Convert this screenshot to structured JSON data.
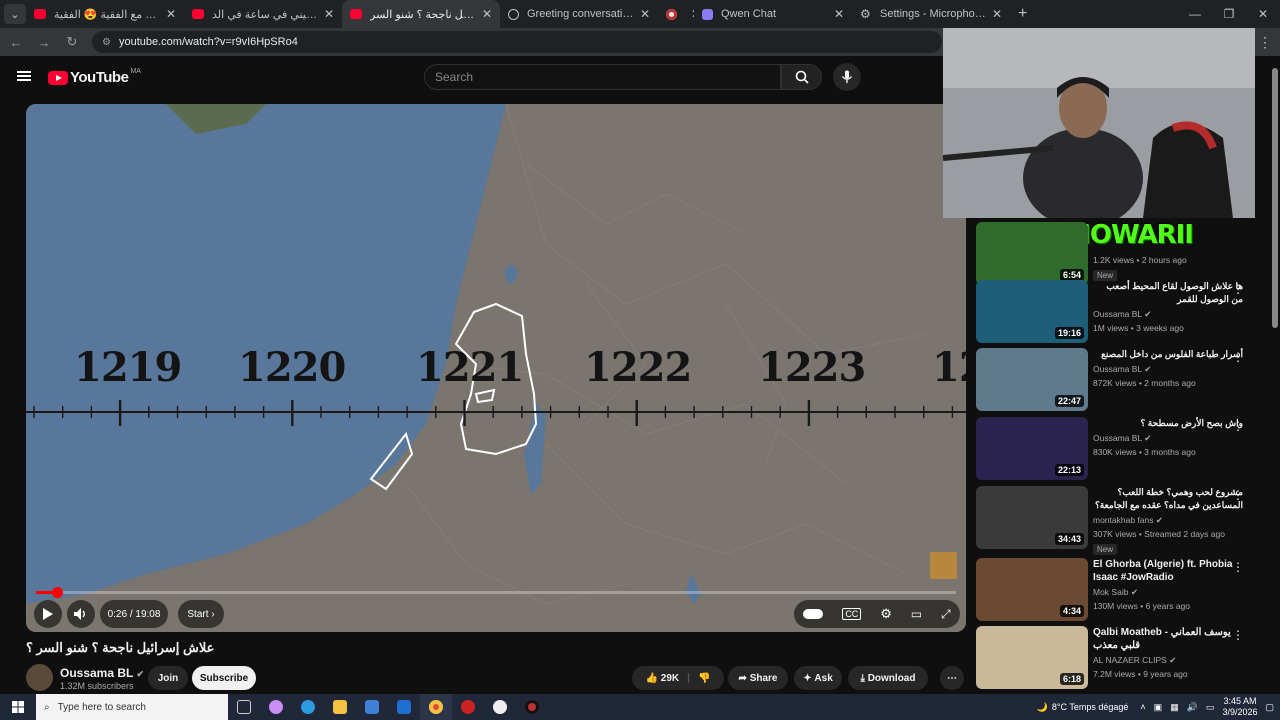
{
  "browser": {
    "tabs": [
      {
        "title": "برنامج الزواج مع الفقية 😍 الفقية",
        "icon": "youtube-icon"
      },
      {
        "title": "الحسين الدجيني في ساعة في الد...",
        "icon": "youtube-icon"
      },
      {
        "title": "علاش إسرائيل ناجحة ؟ شنو السر",
        "icon": "youtube-icon",
        "active": true
      },
      {
        "title": "Greeting conversation",
        "icon": "globe-icon"
      },
      {
        "title": "",
        "icon": "record-icon"
      },
      {
        "title": "Qwen Chat",
        "icon": "qwen-icon"
      },
      {
        "title": "Settings - Microphone",
        "icon": "gear-icon"
      }
    ],
    "url": "youtube.com/watch?v=r9vI6HpSRo4"
  },
  "youtube": {
    "logo": "YouTube",
    "country_code": "MA",
    "search_placeholder": "Search"
  },
  "player": {
    "timeline_years": [
      "1219",
      "1220",
      "1221",
      "1222",
      "1223",
      "12"
    ],
    "progress": 0.023,
    "time": "0:26 / 19:08",
    "chapter": "Start",
    "chapter_arrow": "›"
  },
  "video": {
    "title": "علاش إسرائيل ناجحة ؟ شنو السر ؟",
    "channel": "Oussama BL",
    "subscribers": "1.32M subscribers",
    "join": "Join",
    "subscribe": "Subscribe",
    "likes": "29K",
    "share": "Share",
    "ask": "Ask",
    "download": "Download"
  },
  "overlay": {
    "kick_text": "KICK/LHOWARII"
  },
  "recommendations": [
    {
      "title": "",
      "channel": "",
      "views": "1.2K views • 2 hours ago",
      "duration": "6:54",
      "badge": "New",
      "color": "#2f6b2a"
    },
    {
      "title": "ها علاش الوصول لقاع المحيط أصعب من الوصول للقمر",
      "channel": "Oussama BL",
      "views": "1M views • 3 weeks ago",
      "duration": "19:16",
      "badge": "",
      "color": "#1f5e79"
    },
    {
      "title": "أسرار طباعة الفلوس من داخل المصنع",
      "channel": "Oussama BL",
      "views": "872K views • 2 months ago",
      "duration": "22:47",
      "badge": "",
      "color": "#5f7a8c"
    },
    {
      "title": "واش بصح الأرض مسطحة ؟",
      "channel": "Oussama BL",
      "views": "830K views • 3 months ago",
      "duration": "22:13",
      "badge": "",
      "color": "#2a2350"
    },
    {
      "title": "مشروع لحب وهمي؟ خطة اللعب؟ المساعدين في مداه؟ عقده مع الجامعة؟",
      "channel": "montakhab fans",
      "views": "307K views • Streamed 2 days ago",
      "duration": "34:43",
      "badge": "New",
      "color": "#3a3a3a"
    },
    {
      "title": "El Ghorba (Algerie) ft. Phobia Isaac #JowRadio",
      "channel": "Mok Saib",
      "views": "130M views • 6 years ago",
      "duration": "4:34",
      "badge": "",
      "color": "#6b4a34",
      "ltr": true
    },
    {
      "title": "Qalbi Moatheb يوسف العماني - قلبي معذب",
      "channel": "AL NAZAER CLIPS",
      "views": "7.2M views • 9 years ago",
      "duration": "6:18",
      "badge": "",
      "color": "#c9b89a",
      "ltr": true
    }
  ],
  "taskbar": {
    "search_placeholder": "Type here to search",
    "weather": "8°C  Temps dégagé",
    "time": "3:45 AM",
    "date": "3/9/2026"
  }
}
